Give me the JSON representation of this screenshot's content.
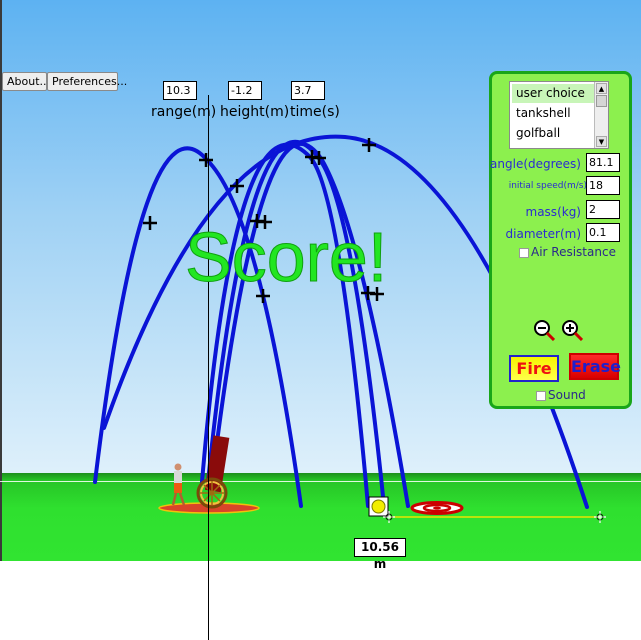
{
  "toolbar": {
    "about_label": "About...",
    "preferences_label": "Preferences..."
  },
  "readouts": {
    "range_value": "10.3",
    "range_label": "range(m)",
    "height_value": "-1.2",
    "height_label": "height(m)",
    "time_value": "3.7",
    "time_label": "time(s)"
  },
  "score_text": "Score!",
  "panel": {
    "projectiles": [
      "user choice",
      "tankshell",
      "golfball"
    ],
    "selected_projectile": "user choice",
    "angle_label": "angle(degrees)",
    "angle_value": "81.1",
    "speed_label": "initial speed(m/s)",
    "speed_value": "18",
    "mass_label": "mass(kg)",
    "mass_value": "2",
    "diameter_label": "diameter(m)",
    "diameter_value": "0.1",
    "air_resistance_label": "Air Resistance",
    "air_resistance_checked": false,
    "zoom_out_icon": "magnifier-minus-icon",
    "zoom_in_icon": "magnifier-plus-icon",
    "fire_label": "Fire",
    "erase_label": "Erase",
    "sound_label": "Sound",
    "sound_checked": false
  },
  "measure": {
    "distance_label": "10.56 m"
  },
  "colors": {
    "trajectory": "#0a14d6",
    "sky_top": "#5db2f2",
    "ground": "#2fe02f",
    "panel_bg": "#8cf04e",
    "panel_border": "#19a619",
    "score": "#22e622"
  }
}
